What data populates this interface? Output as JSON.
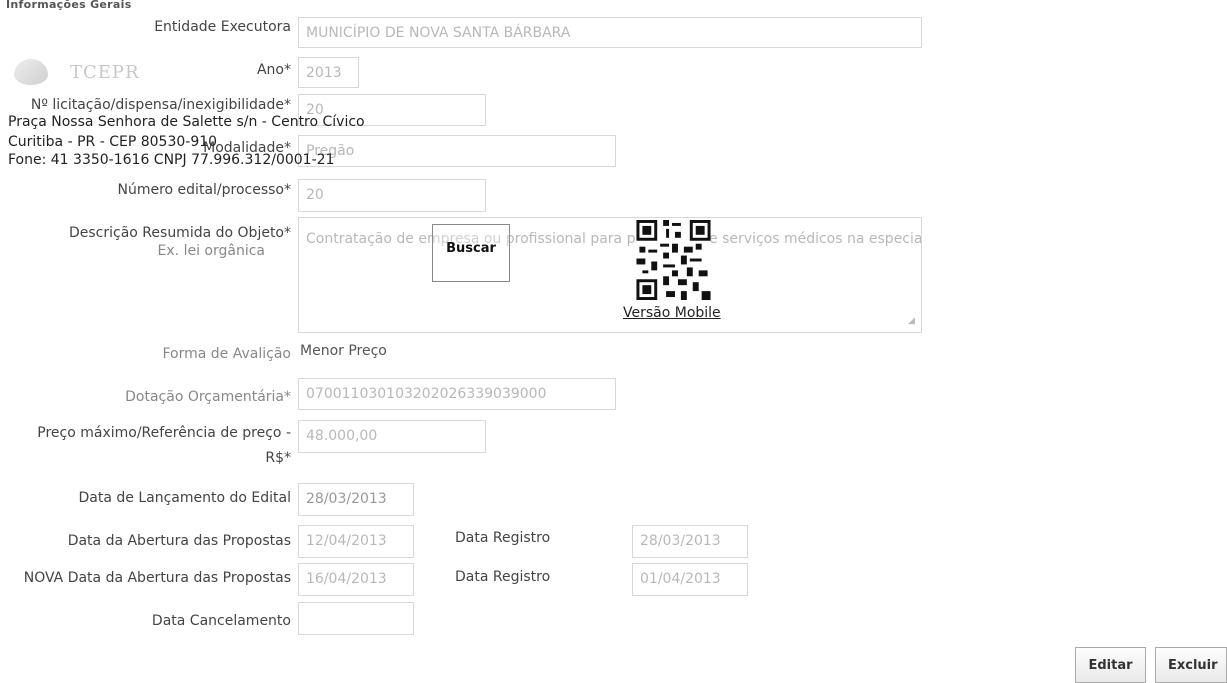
{
  "section_title": "Informações Gerais",
  "logo": {
    "text": "TCEPR"
  },
  "address": {
    "line1": "Praça Nossa Senhora de Salette s/n - Centro Cívico",
    "line2": "Curitiba - PR - CEP 80530-910",
    "line3": "Fone: 41 3350-1616  CNPJ 77.996.312/0001-21"
  },
  "form": {
    "entidade_label": "Entidade Executora",
    "entidade_value": "MUNICÍPIO DE NOVA SANTA BÁRBARA",
    "ano_label": "Ano*",
    "ano_value": "2013",
    "licitacao_label": "Nº licitação/dispensa/inexigibilidade*",
    "licitacao_value": "20",
    "modalidade_label": "Modalidade*",
    "modalidade_value": "Pregão",
    "edital_label": "Número edital/processo*",
    "edital_value": "20",
    "descricao_label": "Descrição Resumida do Objeto*",
    "descricao_sub": "Ex. lei orgânica",
    "descricao_value": "Contratação de empresa ou profissional para prestação de serviços médicos na especialidade ginecologia e obstetrícia",
    "forma_label": "Forma de Avalição",
    "forma_value": "Menor Preço",
    "dotacao_label": "Dotação Orçamentária*",
    "dotacao_value": "070011030103202026339039000",
    "preco_label": "Preço máximo/Referência de preço -",
    "preco_label2": "R$*",
    "preco_value": "48.000,00",
    "lancamento_label": "Data de Lançamento do Edital",
    "lancamento_value": "28/03/2013",
    "abertura_label": "Data da Abertura das Propostas",
    "abertura_value": "12/04/2013",
    "registro1_label": "Data Registro",
    "registro1_value": "28/03/2013",
    "nova_abertura_label": "NOVA Data da Abertura das Propostas",
    "nova_abertura_value": "16/04/2013",
    "registro2_label": "Data Registro",
    "registro2_value": "01/04/2013",
    "cancelamento_label": "Data Cancelamento",
    "cancelamento_value": ""
  },
  "buscar_label": "Buscar",
  "mobile_label": "Versão Mobile",
  "buttons": {
    "editar": "Editar",
    "excluir": "Excluir"
  }
}
